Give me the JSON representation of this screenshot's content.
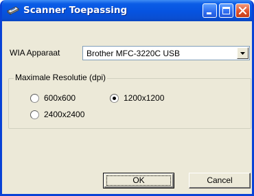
{
  "window": {
    "title": "Scanner Toepassing",
    "icon": "scanner-icon",
    "controls": [
      "minimize-icon",
      "maximize-icon",
      "close-icon"
    ]
  },
  "wia": {
    "label": "WIA Apparaat",
    "selected": "Brother MFC-3220C USB"
  },
  "resolution": {
    "group_title": "Maximale Resolutie (dpi)",
    "options": [
      {
        "label": "600x600",
        "selected": false
      },
      {
        "label": "1200x1200",
        "selected": true
      },
      {
        "label": "2400x2400",
        "selected": false
      }
    ]
  },
  "buttons": {
    "ok": "OK",
    "cancel": "Cancel"
  },
  "colors": {
    "titlebar": "#0653e0",
    "frame": "#0842d6",
    "face": "#ece9d8",
    "close": "#e0542c"
  }
}
